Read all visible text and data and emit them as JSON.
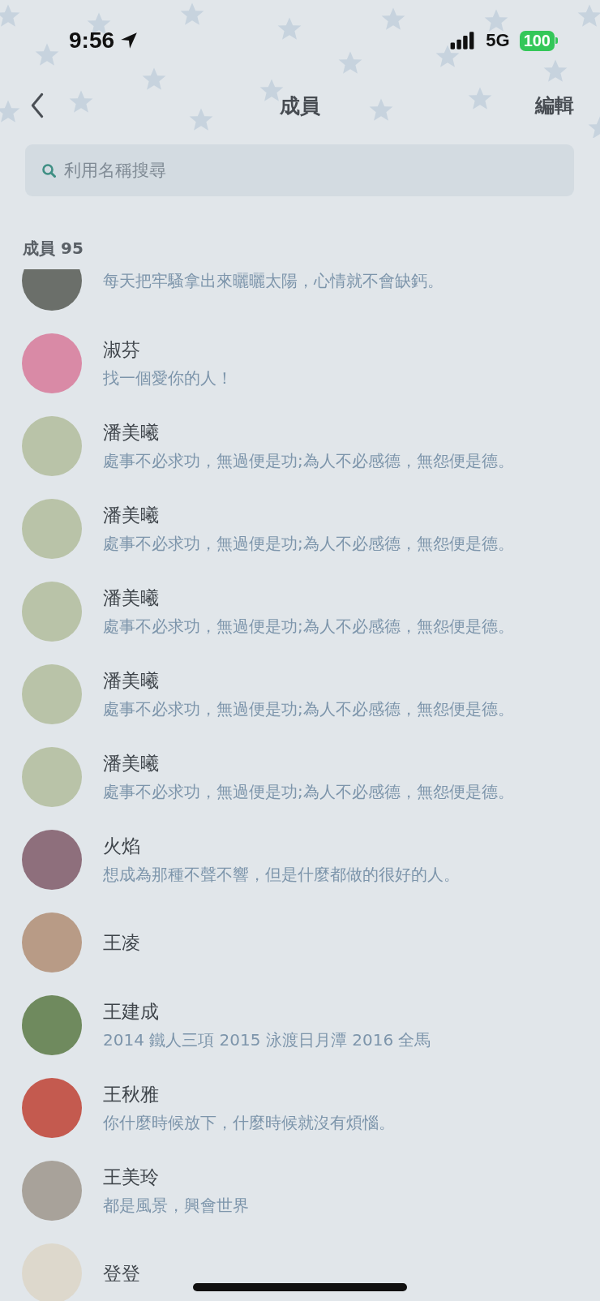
{
  "status_bar": {
    "time": "9:56",
    "network": "5G",
    "battery": "100"
  },
  "nav": {
    "title": "成員",
    "action": "編輯"
  },
  "search": {
    "placeholder": "利用名稱搜尋"
  },
  "section": {
    "label": "成員 95"
  },
  "members": [
    {
      "status": "每天把牢騷拿出來曬曬太陽，心情就不會缺鈣。",
      "color": "#6b6f6a"
    },
    {
      "name": "淑芬",
      "status": "找一個愛你的人！",
      "color": "#d98aa6"
    },
    {
      "name": "潘美曦",
      "status": "處事不必求功，無過便是功;為人不必感德，無怨便是德。",
      "color": "#b9c3a8"
    },
    {
      "name": "潘美曦",
      "status": "處事不必求功，無過便是功;為人不必感德，無怨便是德。",
      "color": "#b9c3a8"
    },
    {
      "name": "潘美曦",
      "status": "處事不必求功，無過便是功;為人不必感德，無怨便是德。",
      "color": "#b9c3a8"
    },
    {
      "name": "潘美曦",
      "status": "處事不必求功，無過便是功;為人不必感德，無怨便是德。",
      "color": "#b9c3a8"
    },
    {
      "name": "潘美曦",
      "status": "處事不必求功，無過便是功;為人不必感德，無怨便是德。",
      "color": "#b9c3a8"
    },
    {
      "name": "火焰",
      "status": "想成為那種不聲不響，但是什麼都做的很好的人。",
      "color": "#8e6f7c"
    },
    {
      "name": "王凌",
      "color": "#b89b86"
    },
    {
      "name": "王建成",
      "status": "2014 鐵人三項 2015 泳渡日月潭 2016 全馬",
      "color": "#6f8a5e"
    },
    {
      "name": "王秋雅",
      "status": "你什麼時候放下，什麼時候就沒有煩惱。",
      "color": "#c45a4f"
    },
    {
      "name": "王美玲",
      "status": "都是風景，興會世界",
      "color": "#a8a29a"
    },
    {
      "name": "登登",
      "color": "#ddd8cc"
    }
  ]
}
